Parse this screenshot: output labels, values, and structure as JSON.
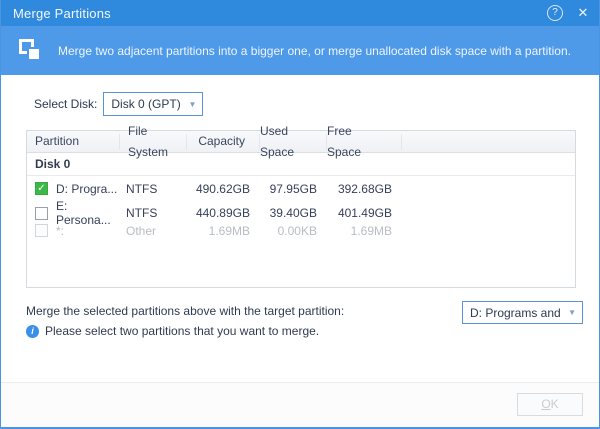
{
  "window": {
    "title": "Merge Partitions"
  },
  "icons": {
    "help": "?",
    "close": "✕",
    "check": "✓",
    "info": "i",
    "dropdown_arrow": "▼"
  },
  "header": {
    "description": "Merge two adjacent partitions into a bigger one, or merge unallocated disk space with a partition."
  },
  "disk_select": {
    "label": "Select Disk:",
    "value": "Disk 0 (GPT)"
  },
  "table": {
    "columns": [
      "Partition",
      "File System",
      "Capacity",
      "Used Space",
      "Free Space"
    ],
    "group_label": "Disk 0",
    "rows": [
      {
        "name": "D: Progra...",
        "file_system": "NTFS",
        "capacity": "490.62GB",
        "used_space": "97.95GB",
        "free_space": "392.68GB",
        "checked": true,
        "enabled": true
      },
      {
        "name": "E: Persona...",
        "file_system": "NTFS",
        "capacity": "440.89GB",
        "used_space": "39.40GB",
        "free_space": "401.49GB",
        "checked": false,
        "enabled": true
      },
      {
        "name": "*:",
        "file_system": "Other",
        "capacity": "1.69MB",
        "used_space": "0.00KB",
        "free_space": "1.69MB",
        "checked": false,
        "enabled": false
      }
    ]
  },
  "target": {
    "label": "Merge the selected partitions above with the target partition:",
    "value": "D: Programs and Install"
  },
  "info_message": "Please select two partitions that you want to merge.",
  "footer": {
    "ok_mnemonic": "O",
    "ok_rest": "K"
  },
  "colors": {
    "titlebar": "#2f8ade",
    "band": "#4f9ae8",
    "accent_border": "#4a94e4",
    "checkbox_checked": "#3eb848",
    "info_icon": "#3a8fe8"
  }
}
